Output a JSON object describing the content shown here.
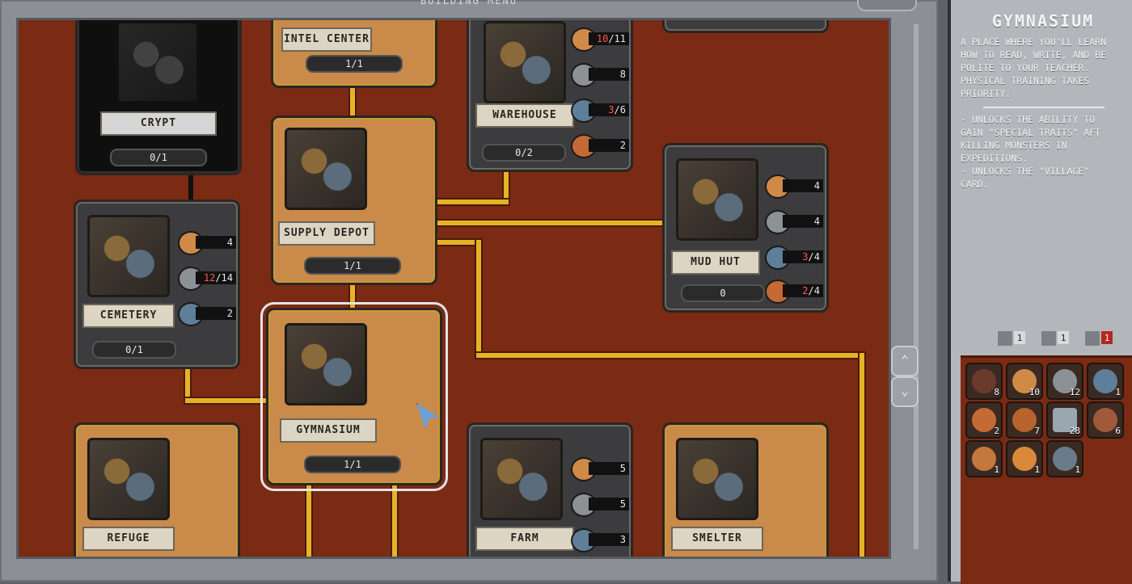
{
  "board": {
    "title": "BUILDING MENU",
    "scroll_up": "⌃",
    "scroll_down": "⌄"
  },
  "buildings": {
    "crypt": {
      "name": "CRYPT",
      "count": "0/1"
    },
    "intel": {
      "name": "INTEL CENTER",
      "count": "1/1"
    },
    "warehouse": {
      "name": "WAREHOUSE",
      "count": "0/2",
      "res": {
        "wood": {
          "have": "10",
          "need": "11"
        },
        "stone": "8",
        "metal": {
          "have": "3",
          "need": "6"
        },
        "food": "2"
      }
    },
    "supply": {
      "name": "SUPPLY DEPOT",
      "count": "1/1"
    },
    "mudhut": {
      "name": "MUD HUT",
      "count": "0",
      "res": {
        "wood": "4",
        "stone": "4",
        "metal": {
          "have": "3",
          "need": "4"
        },
        "food": {
          "have": "2",
          "need": "4"
        }
      }
    },
    "cemetery": {
      "name": "CEMETERY",
      "count": "0/1",
      "res": {
        "wood": "4",
        "stone": {
          "have": "12",
          "need": "14"
        },
        "metal": "2"
      }
    },
    "gymnasium": {
      "name": "GYMNASIUM",
      "count": "1/1"
    },
    "refuge": {
      "name": "REFUGE"
    },
    "farm": {
      "name": "FARM",
      "res": {
        "wood": "5",
        "stone": "5",
        "metal": "3"
      }
    },
    "smelter": {
      "name": "SMELTER"
    }
  },
  "info": {
    "title": "GYMNASIUM",
    "description": "A PLACE WHERE YOU'LL LEARN\nHOW TO READ, WRITE, AND BE\nPOLITE TO YOUR TEACHER.\nPHYSICAL TRAINING TAKES\nPRIORITY.",
    "bullets": "· UNLOCKS THE ABILITY TO\nGAIN \"SPECIAL TRAITS\" AFT\nKILLING MONSTERS IN\nEXPEDITIONS.\n· UNLOCKS THE \"VILLAGE\"\nCARD.",
    "stats": [
      "1",
      "1",
      "1"
    ]
  },
  "inventory": [
    {
      "icon": "crossed-orb-icon",
      "n": "8"
    },
    {
      "icon": "wood-icon",
      "n": "10"
    },
    {
      "icon": "stone-icon",
      "n": "12"
    },
    {
      "icon": "metal-icon",
      "n": "1"
    },
    {
      "icon": "meat-icon",
      "n": "2"
    },
    {
      "icon": "food-icon",
      "n": "7"
    },
    {
      "icon": "scroll-icon",
      "n": "28"
    },
    {
      "icon": "ring-icon",
      "n": "6"
    },
    {
      "icon": "shard-icon",
      "n": "1"
    },
    {
      "icon": "orb-icon",
      "n": "1"
    },
    {
      "icon": "gear-icon",
      "n": "1"
    }
  ],
  "colors": {
    "board_bg": "#7b2a14",
    "path": "#e6b325",
    "need_red": "#ff5a4a"
  }
}
